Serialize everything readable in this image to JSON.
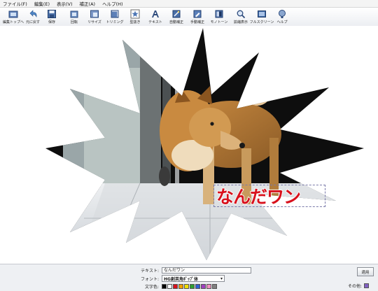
{
  "menu": {
    "items": [
      "ファイル(F)",
      "編集(E)",
      "表示(V)",
      "補正(A)",
      "ヘルプ(H)"
    ]
  },
  "toolbar": {
    "buttons": [
      {
        "label": "編集トップへ",
        "icon": "home-icon"
      },
      {
        "label": "元に戻す",
        "icon": "undo-icon"
      },
      {
        "label": "保存",
        "icon": "save-icon"
      },
      {
        "label": "回転",
        "icon": "rotate-icon"
      },
      {
        "label": "リサイズ",
        "icon": "resize-icon"
      },
      {
        "label": "トリミング",
        "icon": "crop-icon"
      },
      {
        "label": "型抜き",
        "icon": "shape-cut-icon"
      },
      {
        "label": "テキスト",
        "icon": "text-icon"
      },
      {
        "label": "自動補正",
        "icon": "auto-correct-icon"
      },
      {
        "label": "手動補正",
        "icon": "manual-correct-icon"
      },
      {
        "label": "モノトーン",
        "icon": "monotone-icon"
      },
      {
        "label": "拡縮表示",
        "icon": "zoom-icon"
      },
      {
        "label": "フルスクリーン",
        "icon": "fullscreen-icon"
      },
      {
        "label": "ヘルプ",
        "icon": "help-icon"
      }
    ]
  },
  "canvas": {
    "overlay_text": "なんだワン",
    "overlay_color": "#d8101c"
  },
  "bottom_panel": {
    "text_label": "テキスト:",
    "text_value": "なんだワン",
    "font_label": "フォント:",
    "font_value": "HG創英角ﾎﾟｯﾌﾟ体",
    "color_label": "文字色:",
    "other_color_label": "その他:",
    "apply_label": "適用",
    "swatch_colors": [
      "#000000",
      "#ffffff",
      "#d8101c",
      "#f0a000",
      "#f0e000",
      "#30a030",
      "#3060d0",
      "#a040c0",
      "#f090c0",
      "#808080"
    ],
    "selected_color": "#8060c0"
  }
}
